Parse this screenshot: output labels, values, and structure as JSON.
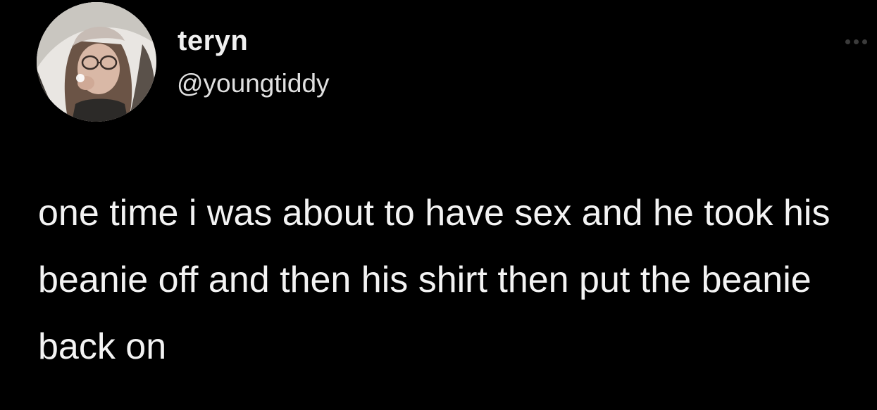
{
  "tweet": {
    "author": {
      "display_name": "teryn",
      "handle": "@youngtiddy",
      "avatar": "profile-photo"
    },
    "more_icon": "more-horizontal-icon",
    "text": "one time i was about to have sex and he took his beanie off and then his shirt then put the beanie back on"
  }
}
